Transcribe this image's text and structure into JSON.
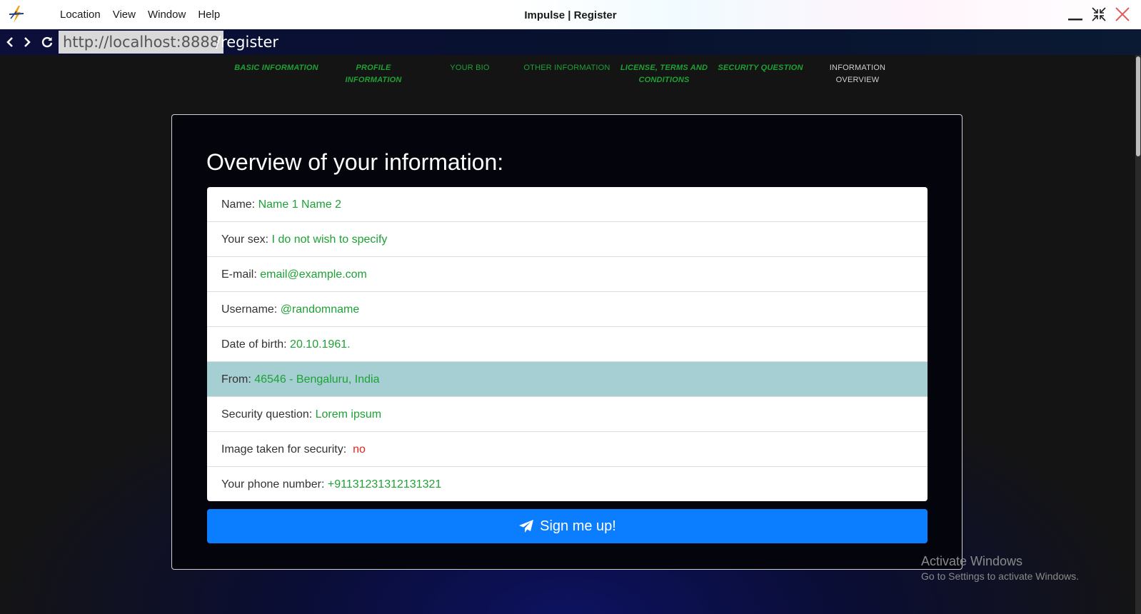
{
  "titlebar": {
    "menu": [
      "Location",
      "View",
      "Window",
      "Help"
    ],
    "title": "Impulse | Register"
  },
  "addressbar": {
    "host": "http://localhost:8888",
    "path": "/register"
  },
  "steps": [
    {
      "label": "BASIC INFORMATION",
      "state": "done"
    },
    {
      "label": "PROFILE INFORMATION",
      "state": "done"
    },
    {
      "label": "YOUR BIO",
      "state": "pending"
    },
    {
      "label": "OTHER INFORMATION",
      "state": "pending"
    },
    {
      "label": "LICENSE, TERMS AND CONDITIONS",
      "state": "done"
    },
    {
      "label": "SECURITY QUESTION",
      "state": "done"
    },
    {
      "label": "INFORMATION OVERVIEW",
      "state": "current"
    }
  ],
  "card": {
    "title": "Overview of your information:",
    "rows": [
      {
        "label": "Name: ",
        "value": "Name 1 Name 2"
      },
      {
        "label": "Your sex: ",
        "value": "I do not wish to specify"
      },
      {
        "label": "E-mail: ",
        "value": "email@example.com"
      },
      {
        "label": "Username: ",
        "value": "@randomname"
      },
      {
        "label": "Date of birth: ",
        "value": "20.10.1961."
      },
      {
        "label": "From: ",
        "value": "46546 - Bengaluru, India"
      },
      {
        "label": "Security question: ",
        "value": "Lorem ipsum"
      },
      {
        "label": "Image taken for security: ",
        "value": "no"
      },
      {
        "label": "Your phone number: ",
        "value": "+91131231312131321"
      }
    ],
    "button_label": "Sign me up!"
  },
  "watermark": {
    "line1": "Activate Windows",
    "line2": "Go to Settings to activate Windows."
  },
  "colors": {
    "accent_green": "#1ea135",
    "button_blue": "#0b7dff",
    "highlight_row": "#a6cfd3",
    "negative_red": "#e0241f"
  }
}
